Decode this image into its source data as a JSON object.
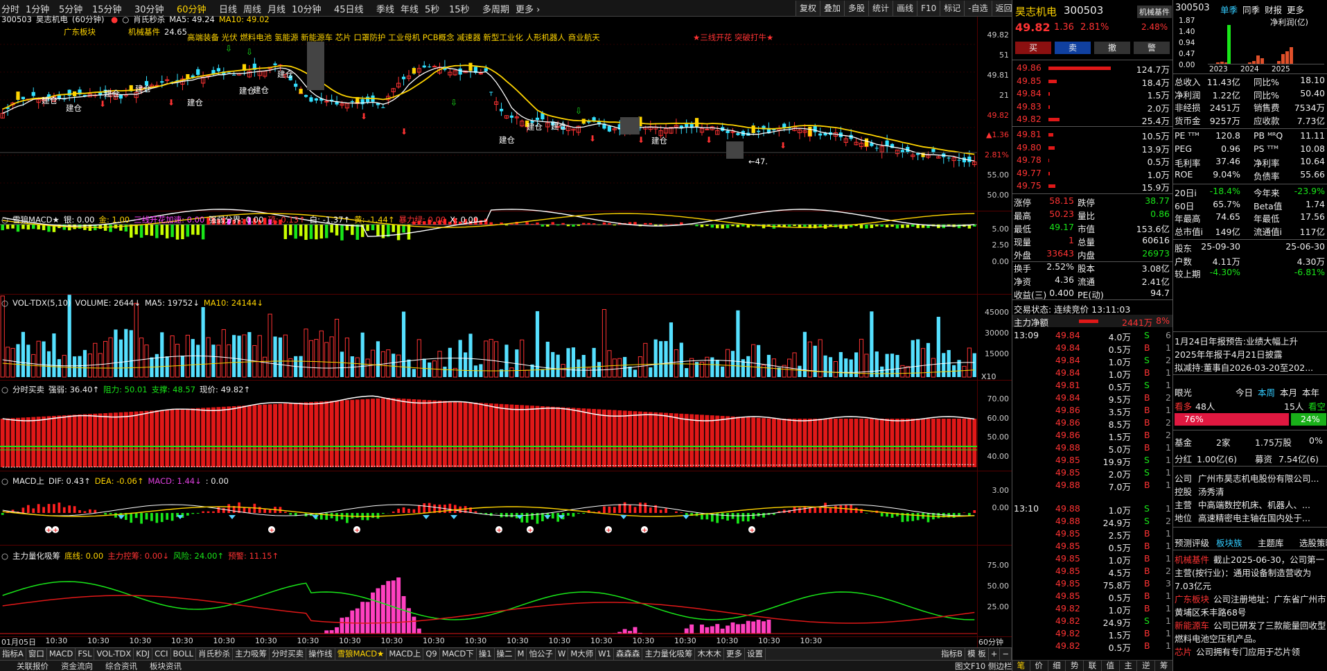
{
  "timeframes": [
    "分时",
    "1分钟",
    "5分钟",
    "15分钟",
    "30分钟",
    "60分钟",
    "日线",
    "周线",
    "月线",
    "10分钟",
    "45日线",
    "季线",
    "年线",
    "5秒",
    "15秒",
    "多周期",
    "更多 ›"
  ],
  "active_timeframe": "60分钟",
  "top_buttons": [
    "复权",
    "叠加",
    "多股",
    "统计",
    "画线",
    "F10",
    "标记",
    "-自选",
    "返回"
  ],
  "main_panel": {
    "code": "300503",
    "name": "昊志机电",
    "period": "(60分钟)",
    "indicator": "肖氏秒杀",
    "ma5": "MA5: 49.24",
    "ma10": "MA10: 49.02",
    "region": "广东板块",
    "concept": "机械基件",
    "concepts": "高端装备 光伏 燃料电池 氢能源 新能源车 芯片 口罩防护 工业母机 PCB概念 减速器 新型工业化 人形机器人 商业航天",
    "signal": "★三线开花 突破打牛★",
    "price_label": "24.65",
    "last_label": "←47.",
    "jiancang": "建仓"
  },
  "macd1_panel": {
    "name": "雪狼MACD★",
    "items": [
      "银: 0.00",
      "金: 1.00",
      "三线开花加速: 0.00",
      "强弱分界: 0.00",
      "顶: 0.13↑",
      "白: -1.37↑",
      "黄: -1.44↑",
      "暴力绿: 0.00",
      "X: 0.00"
    ]
  },
  "vol_panel": {
    "name": "VOL-TDX(5,10)",
    "volume": "VOLUME: 2644↓",
    "ma5": "MA5: 19752↓",
    "ma10": "MA10: 24144↓",
    "unit": "X10"
  },
  "buysell_panel": {
    "name": "分时买卖",
    "strength": "强弱: 36.40↑",
    "resistance": "阻力: 50.01",
    "support": "支撑: 48.57",
    "price": "现价: 49.82↑"
  },
  "macd2_panel": {
    "name": "MACD上",
    "dif": "DIF: 0.43↑",
    "dea": "DEA: -0.06↑",
    "macd": "MACD: 1.44↓",
    "extra": ": 0.00"
  },
  "flow_panel": {
    "name": "主力量化吸筹",
    "bottom": "底线: 0.00",
    "control": "主力控筹: 0.00↓",
    "risk": "风险: 24.00↑",
    "warn": "预警: 11.15↑"
  },
  "y_main": [
    "49.82",
    "51",
    "49.81",
    "21",
    "49.82",
    "▲1.36",
    "2.81%",
    "55.00",
    "50.00"
  ],
  "y_macd1": [
    "5.00",
    "2.50",
    "0.00"
  ],
  "y_vol": [
    "45000",
    "30000",
    "15000"
  ],
  "y_buysell": [
    "70.00",
    "60.00",
    "50.00",
    "40.00"
  ],
  "y_macd2": [
    "3.00",
    "0.00"
  ],
  "y_flow": [
    "75.00",
    "50.00",
    "25.00"
  ],
  "x_axis": [
    "01月05日",
    "10:30",
    "10:30",
    "10:30",
    "10:30",
    "10:30",
    "10:30",
    "10:30",
    "10:30",
    "10:30",
    "10:30",
    "10:30",
    "10:30",
    "10:30",
    "10:30",
    "10:30",
    "10:30",
    "10:30",
    "10:30",
    "10:30"
  ],
  "x_right": "60分钟",
  "bottom_tabs": [
    "指标A",
    "窗口",
    "MACD",
    "FSL",
    "VOL-TDX",
    "KDJ",
    "CCI",
    "BOLL",
    "肖氏秒杀",
    "主力吸筹",
    "分时买卖",
    "操作线",
    "雪狼MACD★",
    "MACD上",
    "Q9",
    "MACD下",
    "操1",
    "操二",
    "M",
    "怕公子",
    "W",
    "M大师",
    "W1",
    "森森森",
    "主力量化吸筹",
    "木木木",
    "更多",
    "设置"
  ],
  "active_tab": "雪狼MACD★",
  "tabs_right": [
    "指标B",
    "模 板",
    "+",
    "−"
  ],
  "status_items": [
    "关联报价",
    "资金流向",
    "综合资讯",
    "板块资讯"
  ],
  "status_right": "图文F10 侧边栏»",
  "quote": {
    "name": "昊志机电",
    "code": "300503",
    "tag": "机械基件",
    "price": "49.82",
    "change": "1.36",
    "pct": "2.81%",
    "tag_pct": "2.48%",
    "buttons": [
      "买",
      "卖",
      "撤",
      "警"
    ]
  },
  "asks": [
    {
      "p": "49.86",
      "v": "124.7万",
      "w": 90
    },
    {
      "p": "49.85",
      "v": "18.4万",
      "w": 12
    },
    {
      "p": "49.84",
      "v": "1.5万",
      "w": 2
    },
    {
      "p": "49.83",
      "v": "2.0万",
      "w": 2
    },
    {
      "p": "49.82",
      "v": "25.4万",
      "w": 16
    }
  ],
  "bids": [
    {
      "p": "49.81",
      "v": "10.5万",
      "w": 7
    },
    {
      "p": "49.80",
      "v": "13.9万",
      "w": 9
    },
    {
      "p": "49.78",
      "v": "0.5万",
      "w": 1
    },
    {
      "p": "49.77",
      "v": "1.0万",
      "w": 2
    },
    {
      "p": "49.75",
      "v": "15.9万",
      "w": 10
    }
  ],
  "stats": [
    [
      "涨停",
      "58.15",
      "跌停",
      "38.77"
    ],
    [
      "最高",
      "50.23",
      "量比",
      "0.86"
    ],
    [
      "最低",
      "49.17",
      "市值",
      "153.6亿"
    ],
    [
      "现量",
      "1",
      "总量",
      "60616"
    ],
    [
      "外盘",
      "33643",
      "内盘",
      "26973"
    ],
    [
      "换手",
      "2.52%",
      "股本",
      "3.08亿"
    ],
    [
      "净资",
      "4.36",
      "流通",
      "2.41亿"
    ],
    [
      "收益(三)",
      "0.400",
      "PE(动)",
      "94.7"
    ]
  ],
  "trade_status": "交易状态: 连续竞价 13:11:03",
  "main_flow": {
    "label": "主力净额",
    "value": "2441万",
    "pct": "8%"
  },
  "ticks": [
    {
      "t": "13:09",
      "p": "49.84",
      "v": "4.0万",
      "d": "S",
      "n": "6"
    },
    {
      "p": "49.84",
      "v": "0.5万",
      "d": "B",
      "n": "1"
    },
    {
      "p": "49.84",
      "v": "1.0万",
      "d": "S",
      "n": "2"
    },
    {
      "p": "49.84",
      "v": "1.0万",
      "d": "B",
      "n": "1"
    },
    {
      "p": "49.81",
      "v": "0.5万",
      "d": "S",
      "n": "1"
    },
    {
      "p": "49.84",
      "v": "9.5万",
      "d": "B",
      "n": "2"
    },
    {
      "p": "49.86",
      "v": "3.5万",
      "d": "B",
      "n": "1"
    },
    {
      "p": "49.86",
      "v": "8.5万",
      "d": "B",
      "n": "2"
    },
    {
      "p": "49.86",
      "v": "1.5万",
      "d": "B",
      "n": "2"
    },
    {
      "p": "49.88",
      "v": "5.0万",
      "d": "B",
      "n": "1"
    },
    {
      "p": "49.85",
      "v": "19.9万",
      "d": "S",
      "n": "1"
    },
    {
      "p": "49.85",
      "v": "2.0万",
      "d": "S",
      "n": "1"
    },
    {
      "p": "49.88",
      "v": "7.0万",
      "d": "B",
      "n": "1"
    },
    {
      "t": "13:10",
      "p": "49.88",
      "v": "1.0万",
      "d": "S",
      "n": "1"
    },
    {
      "p": "49.88",
      "v": "24.9万",
      "d": "S",
      "n": "2"
    },
    {
      "p": "49.85",
      "v": "2.5万",
      "d": "B",
      "n": "1"
    },
    {
      "p": "49.85",
      "v": "0.5万",
      "d": "B",
      "n": "1"
    },
    {
      "p": "49.85",
      "v": "1.0万",
      "d": "B",
      "n": "1"
    },
    {
      "p": "49.85",
      "v": "4.5万",
      "d": "B",
      "n": "2"
    },
    {
      "p": "49.85",
      "v": "75.8万",
      "d": "B",
      "n": "3"
    },
    {
      "p": "49.85",
      "v": "0.5万",
      "d": "B",
      "n": "1"
    },
    {
      "p": "49.82",
      "v": "1.0万",
      "d": "B",
      "n": "1"
    },
    {
      "p": "49.82",
      "v": "24.9万",
      "d": "S",
      "n": "1"
    },
    {
      "p": "49.82",
      "v": "1.5万",
      "d": "B",
      "n": "1"
    },
    {
      "p": "49.82",
      "v": "0.5万",
      "d": "B",
      "n": "1"
    },
    {
      "t": "13:11",
      "p": "49.82",
      "v": "0.5万",
      "d": "B",
      "n": "1"
    }
  ],
  "mid_bottom_tabs": [
    "笔",
    "价",
    "细",
    "势",
    "联",
    "值",
    "主",
    "逆",
    "筹"
  ],
  "fin": {
    "code": "300503",
    "tabs": [
      "单季",
      "同季",
      "财报",
      "更多"
    ],
    "active": "单季",
    "yvals": [
      "1.87",
      "1.40",
      "0.94",
      "0.47",
      "0.00"
    ],
    "years": [
      "2023",
      "2024",
      "2025"
    ],
    "metric": "净利润(亿)"
  },
  "fin_rows": [
    [
      "总收入",
      "11.43亿",
      "同比%",
      "18.10"
    ],
    [
      "净利润",
      "1.22亿",
      "同比%",
      "50.40"
    ],
    [
      "非经损",
      "2451万",
      "销售费",
      "7534万"
    ],
    [
      "货币金",
      "9257万",
      "应收款",
      "7.73亿"
    ],
    [
      "PE ᵀᵀᴹ",
      "120.8",
      "PB ᴹᴿQ",
      "11.11"
    ],
    [
      "PEG",
      "0.96",
      "PS ᵀᵀᴹ",
      "10.08"
    ],
    [
      "毛利率",
      "37.46",
      "净利率",
      "10.64"
    ],
    [
      "ROE",
      "9.04%",
      "负债率",
      "55.66"
    ],
    [
      "20日i",
      "-18.4%",
      "今年来",
      "-23.9%"
    ],
    [
      "60日",
      "65.7%",
      "Beta值",
      "1.74"
    ],
    [
      "年最高",
      "74.65",
      "年最低",
      "17.56"
    ],
    [
      "总市值i",
      "149亿",
      "流通值i",
      "117亿"
    ],
    [
      "股东",
      "25-09-30",
      "",
      "25-06-30"
    ],
    [
      "户数",
      "4.11万",
      "",
      "4.30万"
    ],
    [
      "较上期",
      "-4.30%",
      "",
      "-6.81%"
    ]
  ],
  "news": [
    "1月24日年报预告:业绩大幅上升",
    "2025年年报于4月21日披露",
    "拟减持:董事自2026-03-20至202..."
  ],
  "sentiment": {
    "label": "眼光",
    "tabs": [
      "今日",
      "本周",
      "本月",
      "本年"
    ],
    "active": "本周",
    "bull": "看多",
    "bull_n": "48人",
    "bear_n": "15人",
    "bear": "看空",
    "bull_pct": "76%",
    "bear_pct": "24%"
  },
  "fund": {
    "label": "基金",
    "count": "2家",
    "shares": "1.75万股",
    "pct": "0%"
  },
  "dividend": {
    "label": "分红",
    "v1": "1.00亿(6)",
    "label2": "募资",
    "v2": "7.54亿(6)"
  },
  "company": [
    [
      "公司",
      "广州市昊志机电股份有限公司..."
    ],
    [
      "控股",
      "汤秀清"
    ],
    [
      "主营",
      "中高端数控机床、机器人、..."
    ],
    [
      "地位",
      "高速精密电主轴在国内处于..."
    ]
  ],
  "links": [
    "预测评级",
    "板块族",
    "主题库",
    "选股策略"
  ],
  "info_blocks": [
    {
      "tag": "机械基件",
      "text": "截止2025-06-30，公司第一主营(按行业)：通用设备制造营收为7.03亿元"
    },
    {
      "tag": "广东板块",
      "text": "公司注册地址：广东省广州市黄埔区禾丰路68号"
    },
    {
      "tag": "新能源车",
      "text": "公司已研发了三款能量回收型燃料电池空压机产品。"
    },
    {
      "tag": "芯片",
      "text": "公司拥有专门应用于芯片领"
    }
  ]
}
